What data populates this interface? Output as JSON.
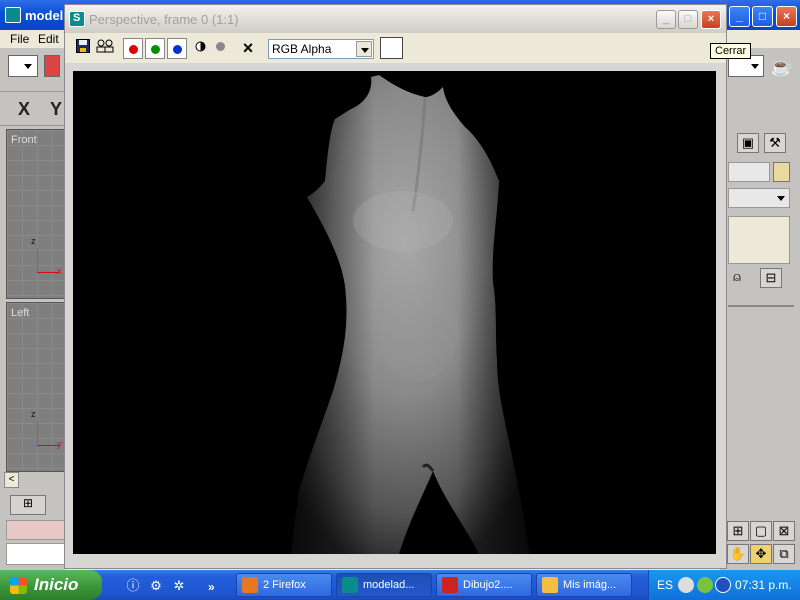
{
  "main_window": {
    "title": "model",
    "menu": [
      "File",
      "Edit"
    ],
    "axis_x": "X",
    "axis_y": "Y",
    "viewports": [
      {
        "label": "Front",
        "axis_v": "z",
        "axis_h": "x"
      },
      {
        "label": "Left",
        "axis_v": "z",
        "axis_h": "y"
      }
    ],
    "controls": {
      "minimize": "_",
      "maximize": "□",
      "close": "×"
    }
  },
  "tooltip": "Cerrar",
  "frame_window": {
    "title": "Perspective, frame 0 (1:1)",
    "controls": {
      "minimize": "_",
      "maximize": "□",
      "close": "×"
    },
    "toolbar": {
      "save_icon": "floppy-disk-icon",
      "clone_icon": "clone-icon",
      "red_color": "#e00000",
      "green_color": "#009000",
      "blue_color": "#0030d0",
      "clear_label": "×",
      "channel_value": "RGB Alpha"
    }
  },
  "taskbar": {
    "start_label": "Inicio",
    "overflow": "»",
    "tasks": [
      {
        "label": "2 Firefox",
        "icon_color": "#e87820"
      },
      {
        "label": "modelad...",
        "icon_color": "#0b8c8c"
      },
      {
        "label": "Dibujo2....",
        "icon_color": "#cc2222"
      },
      {
        "label": "Mis imág...",
        "icon_color": "#f0c040"
      }
    ],
    "language": "ES",
    "clock": "07:31 p.m."
  }
}
